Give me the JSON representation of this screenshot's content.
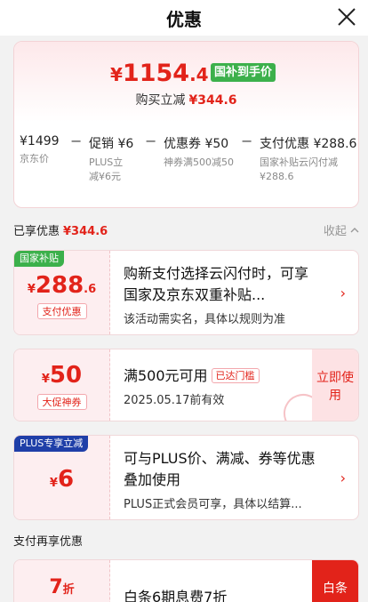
{
  "header": {
    "title": "优惠"
  },
  "price": {
    "symbol": "¥",
    "integer": "1154",
    "decimal": ".4",
    "badge": "国补到手价",
    "reduce_label": "购买立减",
    "reduce_amount": "¥344.6"
  },
  "breakdown": [
    {
      "main": "¥1499",
      "sub": "京东价"
    },
    {
      "main": "促销 ¥6",
      "sub": "PLUS立减¥6元"
    },
    {
      "main": "优惠券 ¥50",
      "sub": "神券满500减50"
    },
    {
      "main": "支付优惠 ¥288.6",
      "sub": "国家补贴云闪付减¥288.6"
    }
  ],
  "operators": [
    "−",
    "−",
    "−"
  ],
  "enjoyed": {
    "label": "已享优惠",
    "amount": "¥344.6",
    "collapse": "收起"
  },
  "offers": {
    "subsidy": {
      "tag": "国家补贴",
      "symbol": "¥",
      "amount": "288",
      "decimal": ".6",
      "label": "支付优惠",
      "title": "购新支付选择云闪付时，可享国家及京东双重补贴...",
      "desc": "该活动需实名，具体以规则为准"
    },
    "coupon": {
      "symbol": "¥",
      "amount": "50",
      "label": "大促神券",
      "title": "满500元可用",
      "badge": "已达门槛",
      "desc": "2025.05.17前有效",
      "button": "立即使用"
    },
    "plus": {
      "tag": "PLUS专享立减",
      "symbol": "¥",
      "amount": "6",
      "title": "可与PLUS价、满减、券等优惠叠加使用",
      "desc": "PLUS正式会员可享，具体以结算..."
    }
  },
  "payment": {
    "label": "支付再享优惠",
    "discount": "7",
    "unit": "折",
    "title": "白条6期息费7折",
    "side": "白条"
  },
  "colors": {
    "accent": "#e2231a",
    "green": "#3cb04b",
    "plus_blue": "#1f3fa8"
  }
}
